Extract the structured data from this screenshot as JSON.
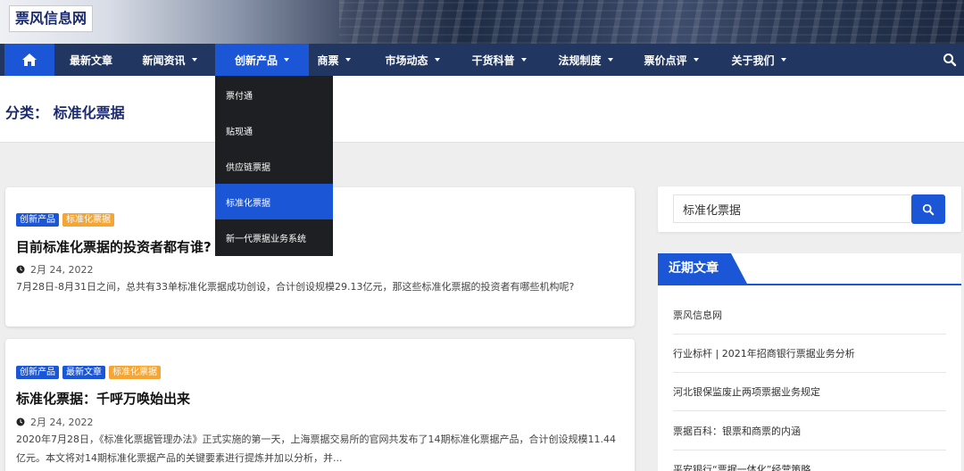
{
  "site": {
    "logo_text": "票风信息网"
  },
  "nav": {
    "items": [
      {
        "label": "最新文章"
      },
      {
        "label": "新闻资讯"
      },
      {
        "label": "创新产品"
      },
      {
        "label": "商票"
      },
      {
        "label": "市场动态"
      },
      {
        "label": "干货科普"
      },
      {
        "label": "法规制度"
      },
      {
        "label": "票价点评"
      },
      {
        "label": "关于我们"
      }
    ],
    "active": "创新产品"
  },
  "dropdown": {
    "items": [
      {
        "label": "票付通"
      },
      {
        "label": "贴现通"
      },
      {
        "label": "供应链票据"
      },
      {
        "label": "标准化票据"
      },
      {
        "label": "新一代票据业务系统"
      }
    ],
    "active": "标准化票据"
  },
  "category": {
    "title": "分类：  标准化票据"
  },
  "articles": [
    {
      "tags": [
        {
          "label": "创新产品",
          "color": "#1a56d6"
        },
        {
          "label": "标准化票据",
          "color": "#f4a533"
        }
      ],
      "title": "目前标准化票据的投资者都有谁?",
      "date": "2月 24, 2022",
      "excerpt": "7月28日-8月31日之间，总共有33单标准化票据成功创设，合计创设规模29.13亿元，那这些标准化票据的投资者有哪些机构呢?"
    },
    {
      "tags": [
        {
          "label": "创新产品",
          "color": "#1a56d6"
        },
        {
          "label": "最新文章",
          "color": "#1a56d6"
        },
        {
          "label": "标准化票据",
          "color": "#f4a533"
        }
      ],
      "title": "标准化票据：千呼万唤始出来",
      "date": "2月 24, 2022",
      "excerpt": "2020年7月28日，《标准化票据管理办法》正式实施的第一天，上海票据交易所的官网共发布了14期标准化票据产品，合计创设规模11.44亿元。本文将对14期标准化票据产品的关键要素进行提炼并加以分析，并..."
    }
  ],
  "sidebar": {
    "search": {
      "value": "标准化票据"
    },
    "recent": {
      "title": "近期文章",
      "items": [
        {
          "label": "票风信息网"
        },
        {
          "label": "行业标杆 | 2021年招商银行票据业务分析"
        },
        {
          "label": "河北银保监废止两项票据业务规定"
        },
        {
          "label": "票据百科：银票和商票的内涵"
        },
        {
          "label": "平安银行“票据一体化”经营策略"
        }
      ]
    }
  },
  "colors": {
    "nav_bg": "#213660",
    "accent": "#1a56d6",
    "tag_orange": "#f4a533",
    "dropdown_bg": "#1d1f22"
  },
  "icons": {
    "home": "home-icon",
    "search": "search-icon",
    "clock": "clock-icon"
  }
}
